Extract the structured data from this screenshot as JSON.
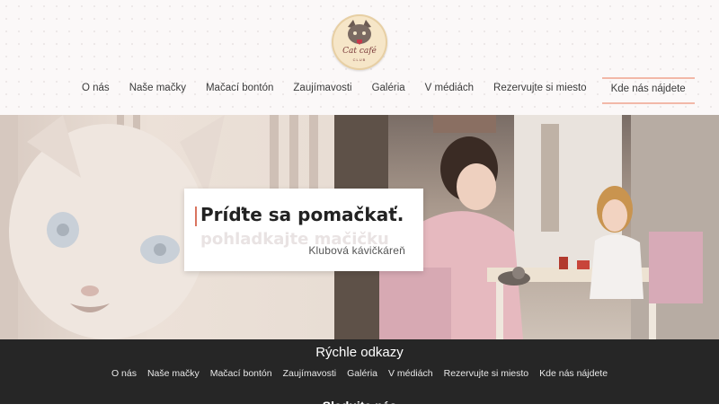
{
  "logo": {
    "text": "Cat café",
    "sub": "CLUB"
  },
  "nav": {
    "items": [
      "O nás",
      "Naše mačky",
      "Mačací bontón",
      "Zaujímavosti",
      "Galéria",
      "V médiách",
      "Rezervujte si miesto",
      "Kde nás nájdete"
    ],
    "active_index": 7
  },
  "hero": {
    "title": "Príďte sa pomačkať.",
    "ghost_text": "pohladkajte mačičku",
    "subtitle": "Klubová kávičkáreň"
  },
  "footer": {
    "title": "Rýchle odkazy",
    "links": [
      "O nás",
      "Naše mačky",
      "Mačací bontón",
      "Zaujímavosti",
      "Galéria",
      "V médiách",
      "Rezervujte si miesto",
      "Kde nás nájdete"
    ],
    "next_heading": "Sledujte nás"
  },
  "colors": {
    "accent": "#f2b8a8",
    "title_bar": "#d9745f",
    "footer_bg": "#262626"
  }
}
